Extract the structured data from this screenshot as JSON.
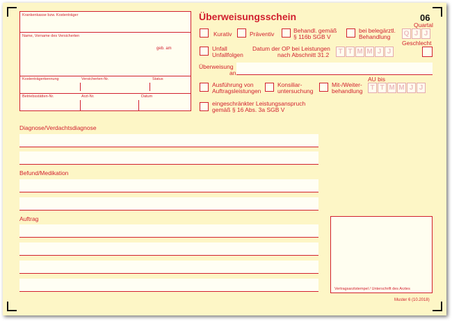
{
  "header": {
    "title": "Überweisungsschein",
    "form_no": "06",
    "quartal_label": "Quartal",
    "geschlecht_label": "Geschlecht"
  },
  "patient_box": {
    "kostentraeger_label": "Krankenkasse bzw. Kostenträger",
    "name_label": "Name, Vorname des Versicherten",
    "geb_label": "geb. am",
    "kostentraegerkennung_label": "Kostenträgerkennung",
    "versicherten_nr_label": "Versicherten-Nr.",
    "status_label": "Status",
    "betriebsstaetten_label": "Betriebsstätten-Nr.",
    "arzt_nr_label": "Arzt-Nr.",
    "datum_label": "Datum"
  },
  "checks": {
    "kurativ": "Kurativ",
    "praeventiv": "Präventiv",
    "behandl_1": "Behandl. gemäß",
    "behandl_2": "§ 116b SGB V",
    "beleg_1": "bei belegärztl.",
    "beleg_2": "Behandlung",
    "unfall_1": "Unfall",
    "unfall_2": "Unfallfolgen",
    "op_1": "Datum der OP bei Leistungen",
    "op_2": "nach Abschnitt 31.2",
    "ueberweisung_1": "Überweisung",
    "ueberweisung_2": "an",
    "ausfuehrung_1": "Ausführung von",
    "ausfuehrung_2": "Auftragsleistungen",
    "konsiliar_1": "Konsiliar-",
    "konsiliar_2": "untersuchung",
    "mitweiter_1": "Mit-/Weiter-",
    "mitweiter_2": "behandlung",
    "au_bis": "AU bis",
    "eingeschr_1": "eingeschränkter Leistungsanspruch",
    "eingeschr_2": "gemäß § 16 Abs. 3a SGB V"
  },
  "cells": {
    "quartal": [
      "Q",
      "J",
      "J"
    ],
    "date": [
      "T",
      "T",
      "M",
      "M",
      "J",
      "J"
    ]
  },
  "sections": {
    "diagnose": "Diagnose/Verdachtsdiagnose",
    "befund": "Befund/Medikation",
    "auftrag": "Auftrag"
  },
  "footer": {
    "stamp_label": "Vertragsarztstempel / Unterschrift des Arztes",
    "muster": "Muster 6 (10.2018)"
  }
}
